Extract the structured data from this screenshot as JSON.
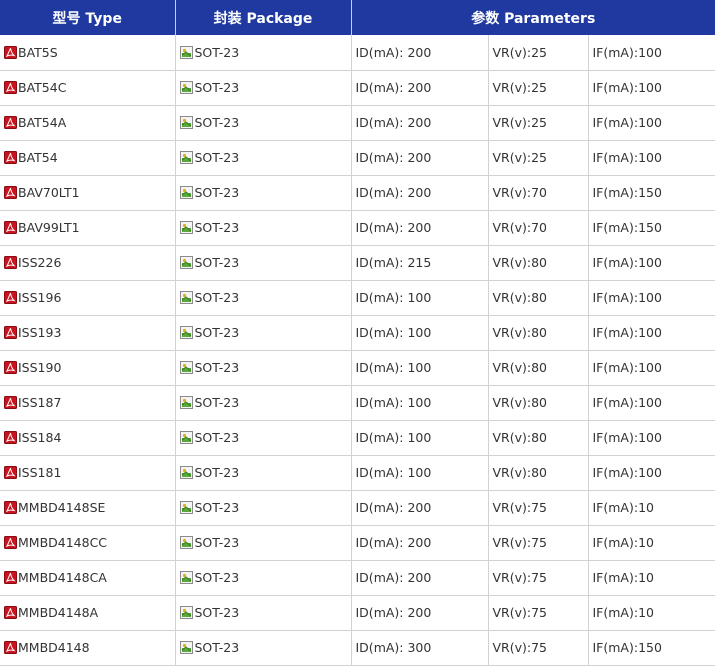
{
  "header": {
    "type": "型号 Type",
    "package": "封装 Package",
    "params": "参数 Parameters"
  },
  "rows": [
    {
      "type": "BAT5S",
      "package": "SOT-23",
      "id": "ID(mA): 200",
      "vr": "VR(v):25",
      "if": "IF(mA):100"
    },
    {
      "type": "BAT54C",
      "package": "SOT-23",
      "id": "ID(mA): 200",
      "vr": "VR(v):25",
      "if": "IF(mA):100"
    },
    {
      "type": "BAT54A",
      "package": "SOT-23",
      "id": "ID(mA): 200",
      "vr": "VR(v):25",
      "if": "IF(mA):100"
    },
    {
      "type": "BAT54",
      "package": "SOT-23",
      "id": "ID(mA): 200",
      "vr": "VR(v):25",
      "if": "IF(mA):100"
    },
    {
      "type": "BAV70LT1",
      "package": "SOT-23",
      "id": "ID(mA): 200",
      "vr": "VR(v):70",
      "if": "IF(mA):150"
    },
    {
      "type": "BAV99LT1",
      "package": "SOT-23",
      "id": "ID(mA): 200",
      "vr": "VR(v):70",
      "if": "IF(mA):150"
    },
    {
      "type": "ISS226",
      "package": "SOT-23",
      "id": "ID(mA): 215",
      "vr": "VR(v):80",
      "if": "IF(mA):100"
    },
    {
      "type": "ISS196",
      "package": "SOT-23",
      "id": "ID(mA): 100",
      "vr": "VR(v):80",
      "if": "IF(mA):100"
    },
    {
      "type": "ISS193",
      "package": "SOT-23",
      "id": "ID(mA): 100",
      "vr": "VR(v):80",
      "if": "IF(mA):100"
    },
    {
      "type": "ISS190",
      "package": "SOT-23",
      "id": "ID(mA): 100",
      "vr": "VR(v):80",
      "if": "IF(mA):100"
    },
    {
      "type": "ISS187",
      "package": "SOT-23",
      "id": "ID(mA): 100",
      "vr": "VR(v):80",
      "if": "IF(mA):100"
    },
    {
      "type": "ISS184",
      "package": "SOT-23",
      "id": "ID(mA): 100",
      "vr": "VR(v):80",
      "if": "IF(mA):100"
    },
    {
      "type": "ISS181",
      "package": "SOT-23",
      "id": "ID(mA): 100",
      "vr": "VR(v):80",
      "if": "IF(mA):100"
    },
    {
      "type": "MMBD4148SE",
      "package": "SOT-23",
      "id": "ID(mA): 200",
      "vr": "VR(v):75",
      "if": "IF(mA):10"
    },
    {
      "type": "MMBD4148CC",
      "package": "SOT-23",
      "id": "ID(mA): 200",
      "vr": "VR(v):75",
      "if": "IF(mA):10"
    },
    {
      "type": "MMBD4148CA",
      "package": "SOT-23",
      "id": "ID(mA): 200",
      "vr": "VR(v):75",
      "if": "IF(mA):10"
    },
    {
      "type": "MMBD4148A",
      "package": "SOT-23",
      "id": "ID(mA): 200",
      "vr": "VR(v):75",
      "if": "IF(mA):10"
    },
    {
      "type": "MMBD4148",
      "package": "SOT-23",
      "id": "ID(mA): 300",
      "vr": "VR(v):75",
      "if": "IF(mA):150"
    }
  ],
  "icons": {
    "type": "pdf-icon",
    "package": "package-image-icon"
  },
  "colors": {
    "header_bg": "#1f39a0",
    "header_text": "#ffffff",
    "grid": "#d2d2d2",
    "pdf_red": "#c8141e"
  }
}
